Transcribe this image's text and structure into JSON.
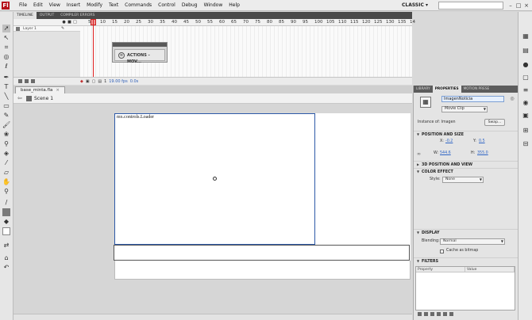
{
  "app": {
    "logo": "Fl"
  },
  "menu": [
    "File",
    "Edit",
    "View",
    "Insert",
    "Modify",
    "Text",
    "Commands",
    "Control",
    "Debug",
    "Window",
    "Help"
  ],
  "workspace": "CLASSIC ▾",
  "window_controls": [
    "–",
    "□",
    "×"
  ],
  "timeline": {
    "tabs": [
      "TIMELINE",
      "OUTPUT",
      "COMPILER ERRORS"
    ],
    "frame_numbers": [
      "5",
      "10",
      "15",
      "20",
      "25",
      "30",
      "35",
      "40",
      "45",
      "50",
      "55",
      "60",
      "65",
      "70",
      "75",
      "80",
      "85",
      "90",
      "95",
      "100",
      "105",
      "110",
      "115",
      "120",
      "125",
      "130",
      "135",
      "14"
    ],
    "layer_name": "Layer 1",
    "actions_label": "ACTIONS - MOV...",
    "footer": {
      "frame": "1",
      "fps": "19.00 fps",
      "time": "0.0s"
    }
  },
  "document": {
    "tab": "base_minta.fla",
    "tab_close": "×",
    "scene": "Scene 1",
    "loader_text": "mx.controls.Loader"
  },
  "properties": {
    "tabs": [
      "LIBRARY",
      "PROPERTIES",
      "MOTION PRESE"
    ],
    "instance_name": "ImagenNoticia",
    "symbol_type": "Movie Clip",
    "instance_of_label": "Instance of:",
    "instance_of_value": "Imagen",
    "swap_label": "Swap...",
    "sections": {
      "position": "POSITION AND SIZE",
      "pos3d": "3D POSITION AND VIEW",
      "color": "COLOR EFFECT",
      "display": "DISPLAY",
      "filters": "FILTERS"
    },
    "x_label": "X:",
    "x_value": "-0.2",
    "y_label": "Y:",
    "y_value": "0.5",
    "w_label": "W:",
    "w_value": "544.6",
    "h_label": "H:",
    "h_value": "355.0",
    "style_label": "Style:",
    "style_value": "None",
    "blending_label": "Blending:",
    "blending_value": "Normal",
    "cache_label": "Cache as bitmap",
    "filter_col_property": "Property",
    "filter_col_value": "Value"
  },
  "colors": {
    "accent": "#2e5aa8",
    "playhead": "#e02020",
    "logo": "#b5121b"
  }
}
